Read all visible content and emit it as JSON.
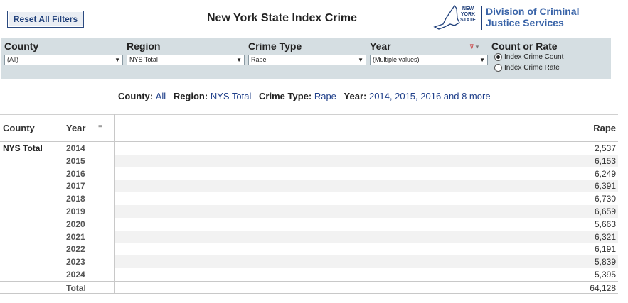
{
  "header": {
    "reset_label": "Reset All Filters",
    "title": "New York State Index Crime",
    "logo_state": "NEW YORK STATE",
    "logo_line1": "Division of Criminal",
    "logo_line2": "Justice Services"
  },
  "filters": {
    "county": {
      "label": "County",
      "value": "(All)"
    },
    "region": {
      "label": "Region",
      "value": "NYS Total"
    },
    "crime_type": {
      "label": "Crime Type",
      "value": "Rape"
    },
    "year": {
      "label": "Year",
      "value": "(Multiple values)"
    },
    "count_or_rate": {
      "label": "Count or Rate",
      "options": [
        "Index Crime Count",
        "Index Crime Rate"
      ],
      "selected": "Index Crime Count"
    }
  },
  "summary": {
    "county_key": "County",
    "county_val": "All",
    "region_key": "Region",
    "region_val": "NYS Total",
    "crime_key": "Crime Type:",
    "crime_val": "Rape",
    "year_key": "Year:",
    "year_val": "2014, 2015, 2016 and 8 more"
  },
  "table": {
    "col_county": "County",
    "col_year": "Year",
    "col_measure": "Rape",
    "county": "NYS Total",
    "rows": [
      {
        "year": "2014",
        "value": "2,537"
      },
      {
        "year": "2015",
        "value": "6,153"
      },
      {
        "year": "2016",
        "value": "6,249"
      },
      {
        "year": "2017",
        "value": "6,391"
      },
      {
        "year": "2018",
        "value": "6,730"
      },
      {
        "year": "2019",
        "value": "6,659"
      },
      {
        "year": "2020",
        "value": "5,663"
      },
      {
        "year": "2021",
        "value": "6,321"
      },
      {
        "year": "2022",
        "value": "6,191"
      },
      {
        "year": "2023",
        "value": "5,839"
      },
      {
        "year": "2024",
        "value": "5,395"
      }
    ],
    "total_label": "Total",
    "total_value": "64,128"
  },
  "colors": {
    "accent": "#1f3f8a",
    "panel": "#d5dee2"
  }
}
